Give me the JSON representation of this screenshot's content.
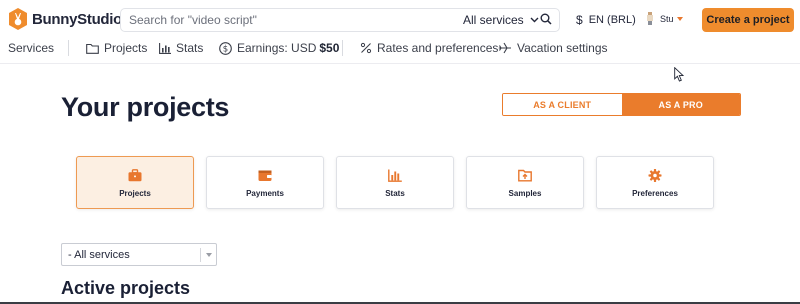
{
  "header": {
    "brand": "BunnyStudio",
    "search_placeholder": "Search for \"video script\"",
    "search_scope": "All services",
    "currency_symbol": "$",
    "language": "EN (BRL)",
    "user_name": "Stu",
    "create_button": "Create a project",
    "accent_color": "#ef8c2d"
  },
  "subnav": {
    "services": "Services",
    "projects": "Projects",
    "stats": "Stats",
    "earnings_label": "Earnings: USD",
    "earnings_value": "$50",
    "rates": "Rates and preferences",
    "vacation": "Vacation settings"
  },
  "main": {
    "title": "Your projects",
    "role_toggle": {
      "client": "AS A CLIENT",
      "pro": "AS A PRO",
      "selected": "pro"
    },
    "cards": [
      {
        "label": "Projects",
        "icon": "briefcase-icon",
        "active": true
      },
      {
        "label": "Payments",
        "icon": "wallet-icon",
        "active": false
      },
      {
        "label": "Stats",
        "icon": "bar-chart-icon",
        "active": false
      },
      {
        "label": "Samples",
        "icon": "folder-upload-icon",
        "active": false
      },
      {
        "label": "Preferences",
        "icon": "gear-icon",
        "active": false
      }
    ],
    "filter": {
      "selected": "- All services"
    },
    "section_title": "Active projects"
  }
}
